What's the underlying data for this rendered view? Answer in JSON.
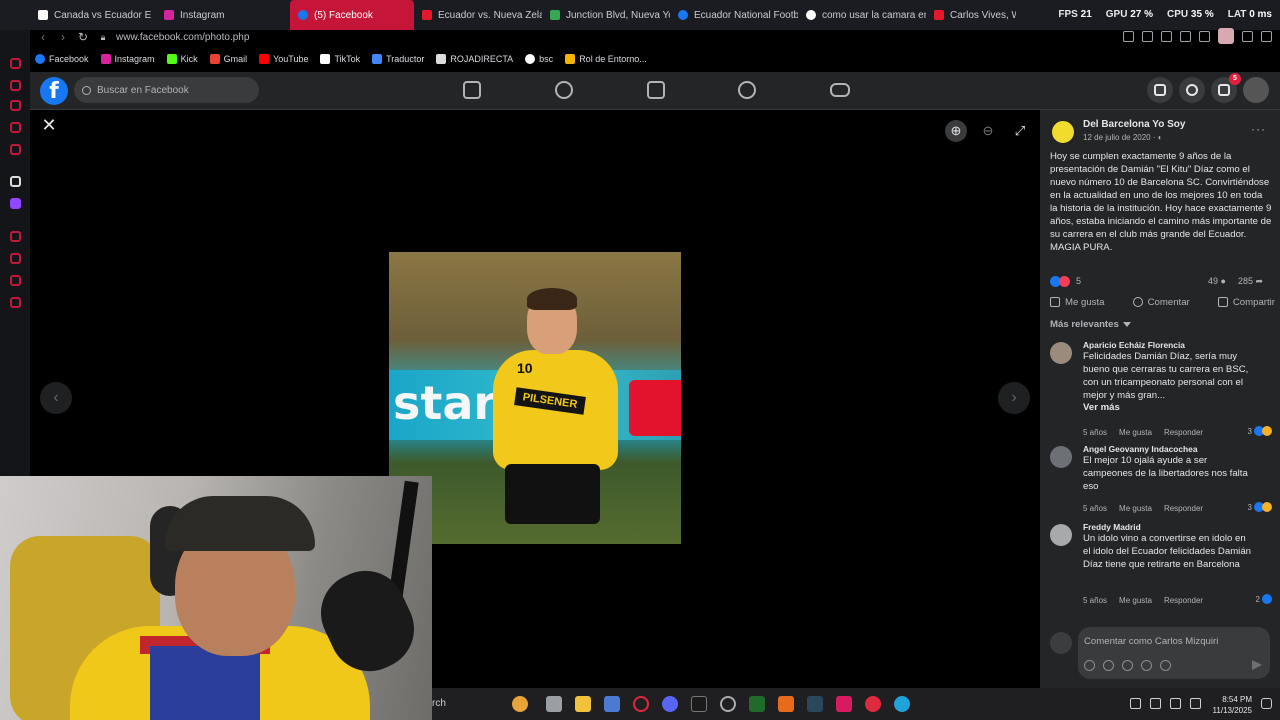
{
  "browser": {
    "tabs": [
      {
        "label": "Canada vs Ecuador E",
        "color": "#ffffff"
      },
      {
        "label": "Instagram",
        "color": "#d6249f"
      },
      {
        "label": "(5) Facebook",
        "color": "#1877f2",
        "active": true
      },
      {
        "label": "Ecuador vs. Nueva Zelan",
        "color": "#e8182c"
      },
      {
        "label": "Junction Blvd, Nueva Yo",
        "color": "#34a853"
      },
      {
        "label": "Ecuador National Footba",
        "color": "#1877f2"
      },
      {
        "label": "como usar la camara en",
        "color": "#ffffff"
      },
      {
        "label": "Carlos Vives, Wisin",
        "color": "#e8182c"
      }
    ],
    "hud": {
      "fps_label": "FPS",
      "fps_value": "21",
      "gpu_label": "GPU",
      "gpu_value": "27 %",
      "cpu_label": "CPU",
      "cpu_value": "35 %",
      "lat_label": "LAT",
      "lat_value": "0 ms"
    },
    "url": "www.facebook.com/photo.php",
    "bookmarks": [
      {
        "label": "Facebook",
        "color": "#1877f2"
      },
      {
        "label": "Instagram",
        "color": "#d6249f"
      },
      {
        "label": "Kick",
        "color": "#53fc18"
      },
      {
        "label": "Gmail",
        "color": "#ea4335"
      },
      {
        "label": "YouTube",
        "color": "#ff0000"
      },
      {
        "label": "TikTok",
        "color": "#ffffff"
      },
      {
        "label": "Traductor",
        "color": "#4285f4"
      },
      {
        "label": "ROJADIRECTA",
        "color": "#dddddd"
      },
      {
        "label": "bsc",
        "color": "#ffffff"
      },
      {
        "label": "Rol de Entorno...",
        "color": "#f4b400"
      }
    ]
  },
  "facebook": {
    "logo": "f",
    "search_placeholder": "Buscar en Facebook",
    "notifications_badge": "5"
  },
  "viewer": {
    "close": "✕",
    "zoom_in": "⊕",
    "zoom_out": "⊖",
    "fullscreen": "⤢",
    "prev": "‹",
    "next": "›",
    "photo": {
      "banner_text": "star",
      "sponsor": "PILSENER",
      "number": "10"
    }
  },
  "post": {
    "page_name": "Del Barcelona Yo Soy",
    "date": "12 de julio de 2020 · ",
    "more": "···",
    "text": "Hoy se cumplen exactamente 9 años de la presentación de Damián \"El Kitu\" Díaz como el nuevo número 10 de Barcelona SC. Convirtiéndose en la actualidad en uno de los mejores 10 en toda la historia de la institución. Hoy hace exactamente 9 años, estaba iniciando el camino más importante de su carrera en el club más grande del Ecuador. MAGIA PURA.",
    "reaction_count": "5",
    "comment_count": "49",
    "share_count": "285",
    "actions": {
      "like": "Me gusta",
      "comment": "Comentar",
      "share": "Compartir"
    },
    "sort_label": "Más relevantes",
    "comments": [
      {
        "author": "Aparicio Echáiz Florencia",
        "text": "Felicidades Damián Díaz, sería muy bueno que cerraras tu carrera en BSC, con un tricampeonato personal con el mejor y más gran...",
        "more": "Ver más",
        "age": "5 años",
        "like": "Me gusta",
        "reply": "Responder",
        "reactions": "3"
      },
      {
        "author": "Angel Geovanny Indacochea",
        "text": "El mejor 10 ojalá ayude a ser campeones de la libertadores nos falta eso",
        "age": "5 años",
        "like": "Me gusta",
        "reply": "Responder",
        "reactions": "3"
      },
      {
        "author": "Freddy Madrid",
        "text": "Un idolo vino a convertirse en idolo en el idolo del Ecuador felicidades Damián Díaz tiene que retirarte en Barcelona",
        "age": "5 años",
        "like": "Me gusta",
        "reply": "Responder",
        "reactions": "2"
      }
    ],
    "composer_placeholder": "Comentar como Carlos Mizquiri"
  },
  "taskbar": {
    "search": "rch",
    "time": "8:54 PM",
    "date": "11/13/2025"
  }
}
